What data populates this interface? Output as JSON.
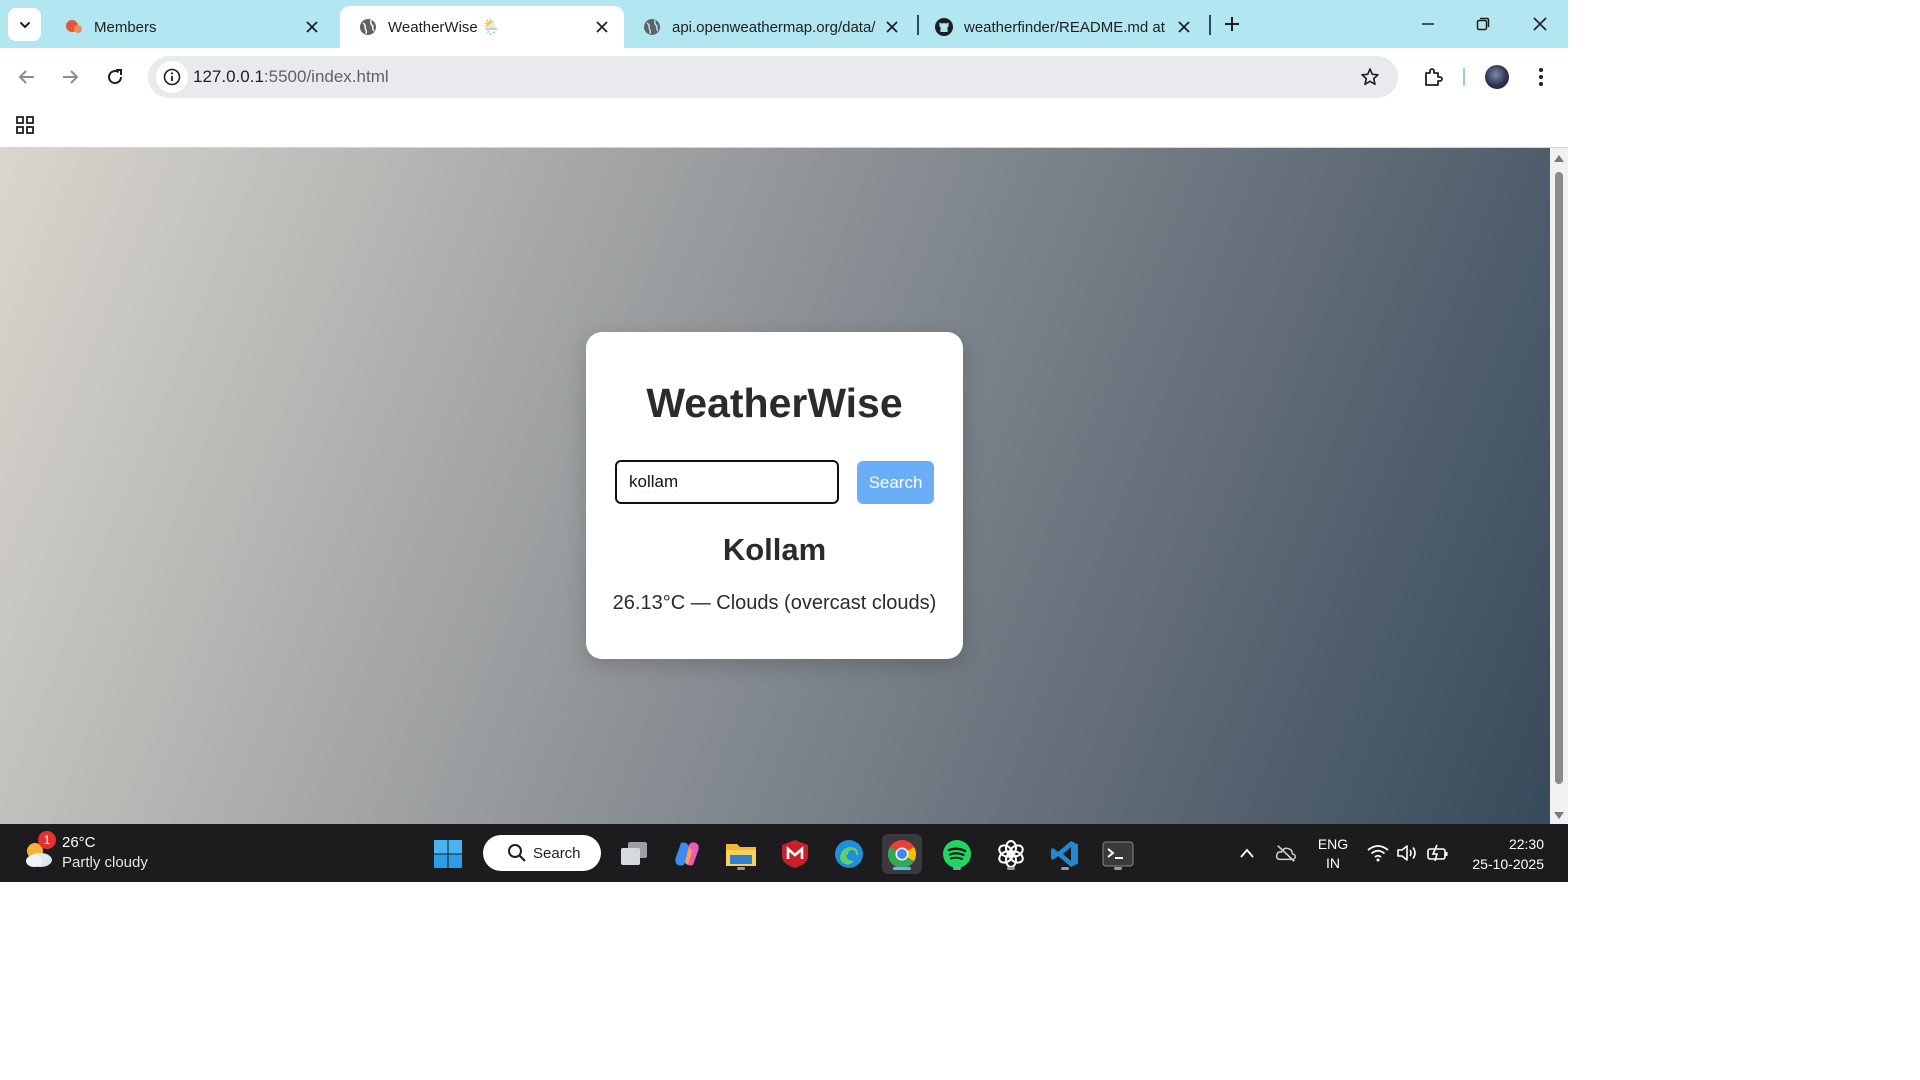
{
  "browser": {
    "tabs": [
      {
        "title": "Members",
        "favicon": "members-favicon",
        "active": false
      },
      {
        "title": "WeatherWise 🌦️",
        "favicon": "globe-icon",
        "active": true
      },
      {
        "title": "api.openweathermap.org/data/",
        "favicon": "globe-icon",
        "active": false
      },
      {
        "title": "weatherfinder/README.md at m",
        "favicon": "github-icon",
        "active": false
      }
    ],
    "address": {
      "host": "127.0.0.1",
      "path": ":5500/index.html"
    }
  },
  "page": {
    "app_title": "WeatherWise",
    "search": {
      "value": "kollam",
      "button_label": "Search"
    },
    "city": "Kollam",
    "weather_line": "26.13°C — Clouds (overcast clouds)"
  },
  "taskbar": {
    "weather": {
      "temp": "26°C",
      "condition": "Partly cloudy",
      "badge": "1"
    },
    "search_label": "Search",
    "apps": [
      "task-view",
      "copilot",
      "file-explorer",
      "mcafee",
      "edge",
      "chrome",
      "spotify",
      "chatgpt",
      "vscode",
      "terminal"
    ],
    "language": {
      "line1": "ENG",
      "line2": "IN"
    },
    "clock": {
      "time": "22:30",
      "date": "25-10-2025"
    }
  },
  "colors": {
    "tabstrip": "#b2e6f0",
    "accent_button": "#6aaef8",
    "taskbar": "#1c1c1e"
  }
}
